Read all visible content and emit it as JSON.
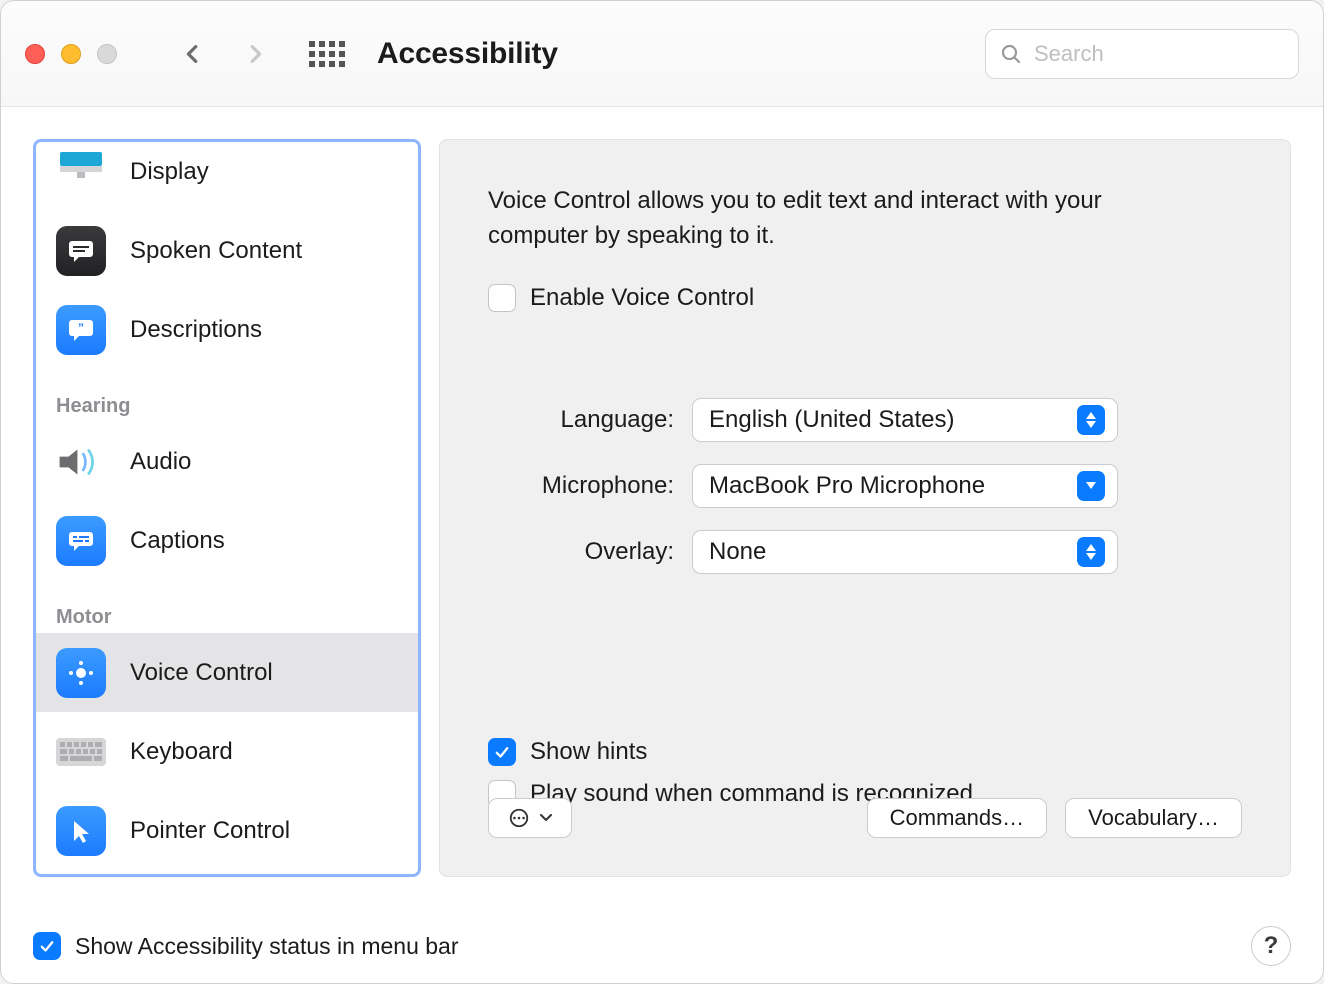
{
  "title": "Accessibility",
  "search_placeholder": "Search",
  "sidebar": {
    "items": [
      {
        "label": "Display"
      },
      {
        "label": "Spoken Content"
      },
      {
        "label": "Descriptions"
      }
    ],
    "section_hearing": "Hearing",
    "hearing_items": [
      {
        "label": "Audio"
      },
      {
        "label": "Captions"
      }
    ],
    "section_motor": "Motor",
    "motor_items": [
      {
        "label": "Voice Control"
      },
      {
        "label": "Keyboard"
      },
      {
        "label": "Pointer Control"
      }
    ]
  },
  "panel": {
    "description": "Voice Control allows you to edit text and interact with your computer by speaking to it.",
    "enable_label": "Enable Voice Control",
    "language_label": "Language:",
    "language_value": "English (United States)",
    "microphone_label": "Microphone:",
    "microphone_value": "MacBook Pro Microphone",
    "overlay_label": "Overlay:",
    "overlay_value": "None",
    "showhints_label": "Show hints",
    "playsound_label": "Play sound when command is recognized",
    "commands_btn": "Commands…",
    "vocabulary_btn": "Vocabulary…"
  },
  "footer": {
    "menubar_label": "Show Accessibility status in menu bar",
    "help": "?"
  }
}
